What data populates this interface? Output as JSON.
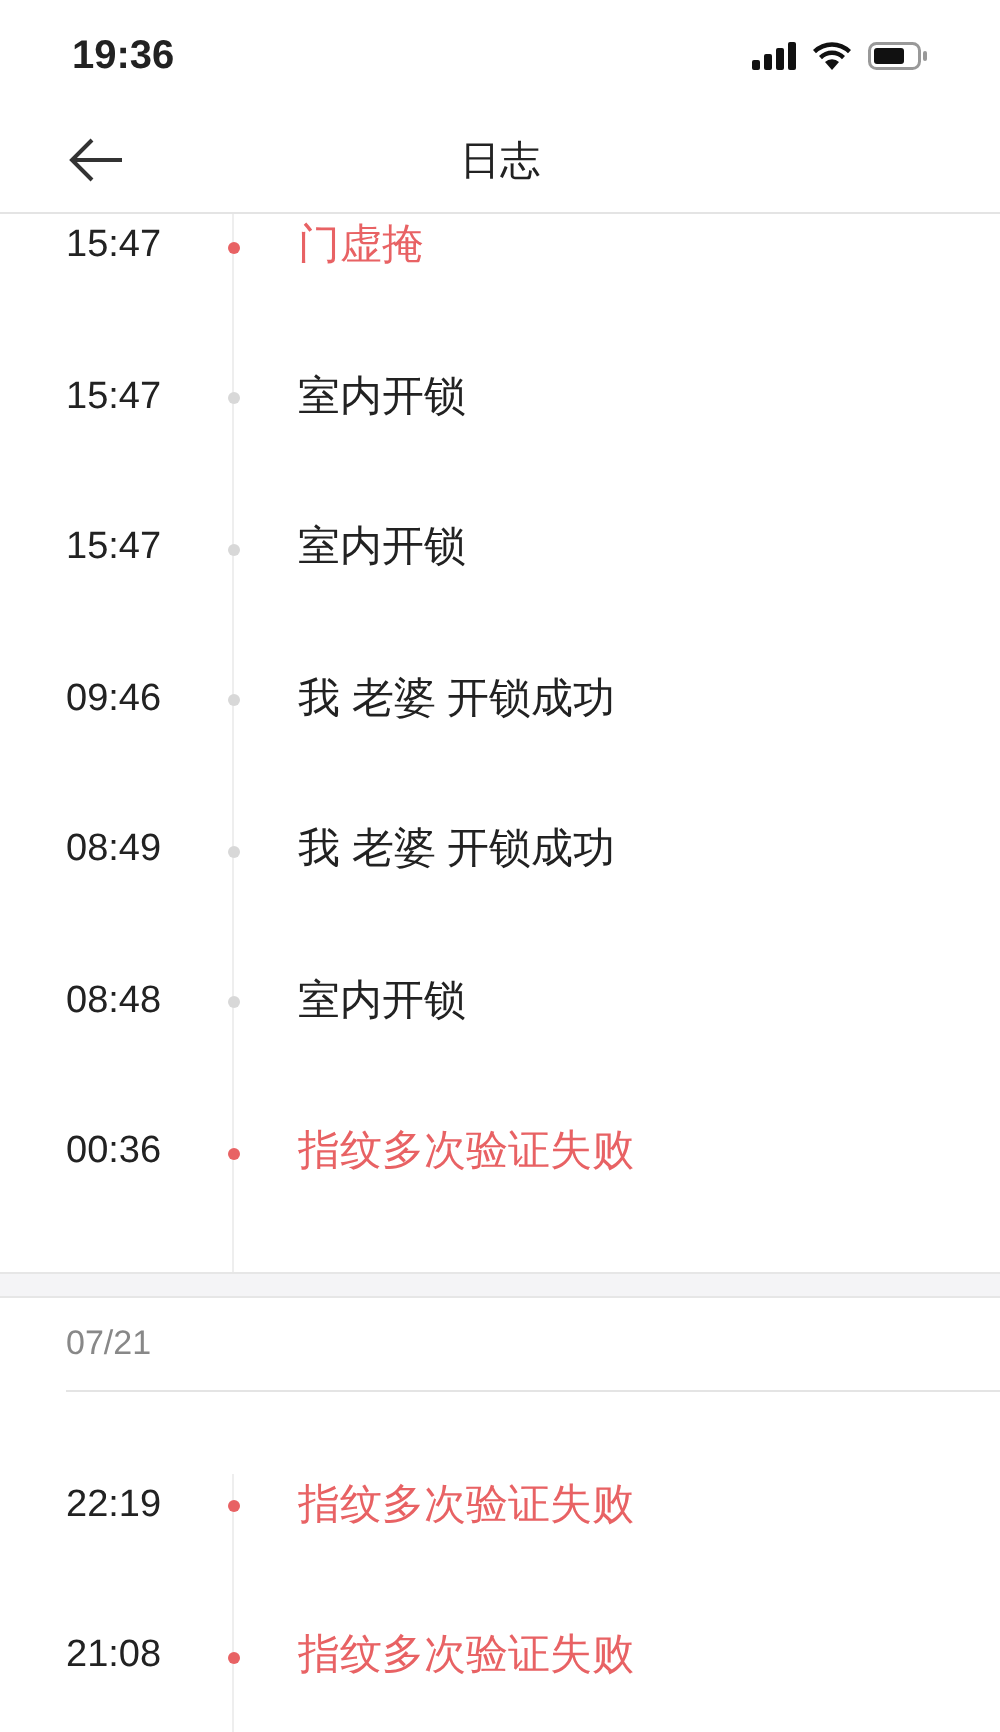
{
  "status_bar": {
    "time": "19:36"
  },
  "header": {
    "title": "日志"
  },
  "sections": [
    {
      "entries": [
        {
          "time": "15:47",
          "event": "门虚掩",
          "alert": true
        },
        {
          "time": "15:47",
          "event": "室内开锁",
          "alert": false
        },
        {
          "time": "15:47",
          "event": "室内开锁",
          "alert": false
        },
        {
          "time": "09:46",
          "event": "我 老婆 开锁成功",
          "alert": false
        },
        {
          "time": "08:49",
          "event": "我 老婆 开锁成功",
          "alert": false
        },
        {
          "time": "08:48",
          "event": "室内开锁",
          "alert": false
        },
        {
          "time": "00:36",
          "event": "指纹多次验证失败",
          "alert": true
        }
      ]
    },
    {
      "date": "07/21",
      "entries": [
        {
          "time": "22:19",
          "event": "指纹多次验证失败",
          "alert": true
        },
        {
          "time": "21:08",
          "event": "指纹多次验证失败",
          "alert": true
        }
      ]
    }
  ]
}
